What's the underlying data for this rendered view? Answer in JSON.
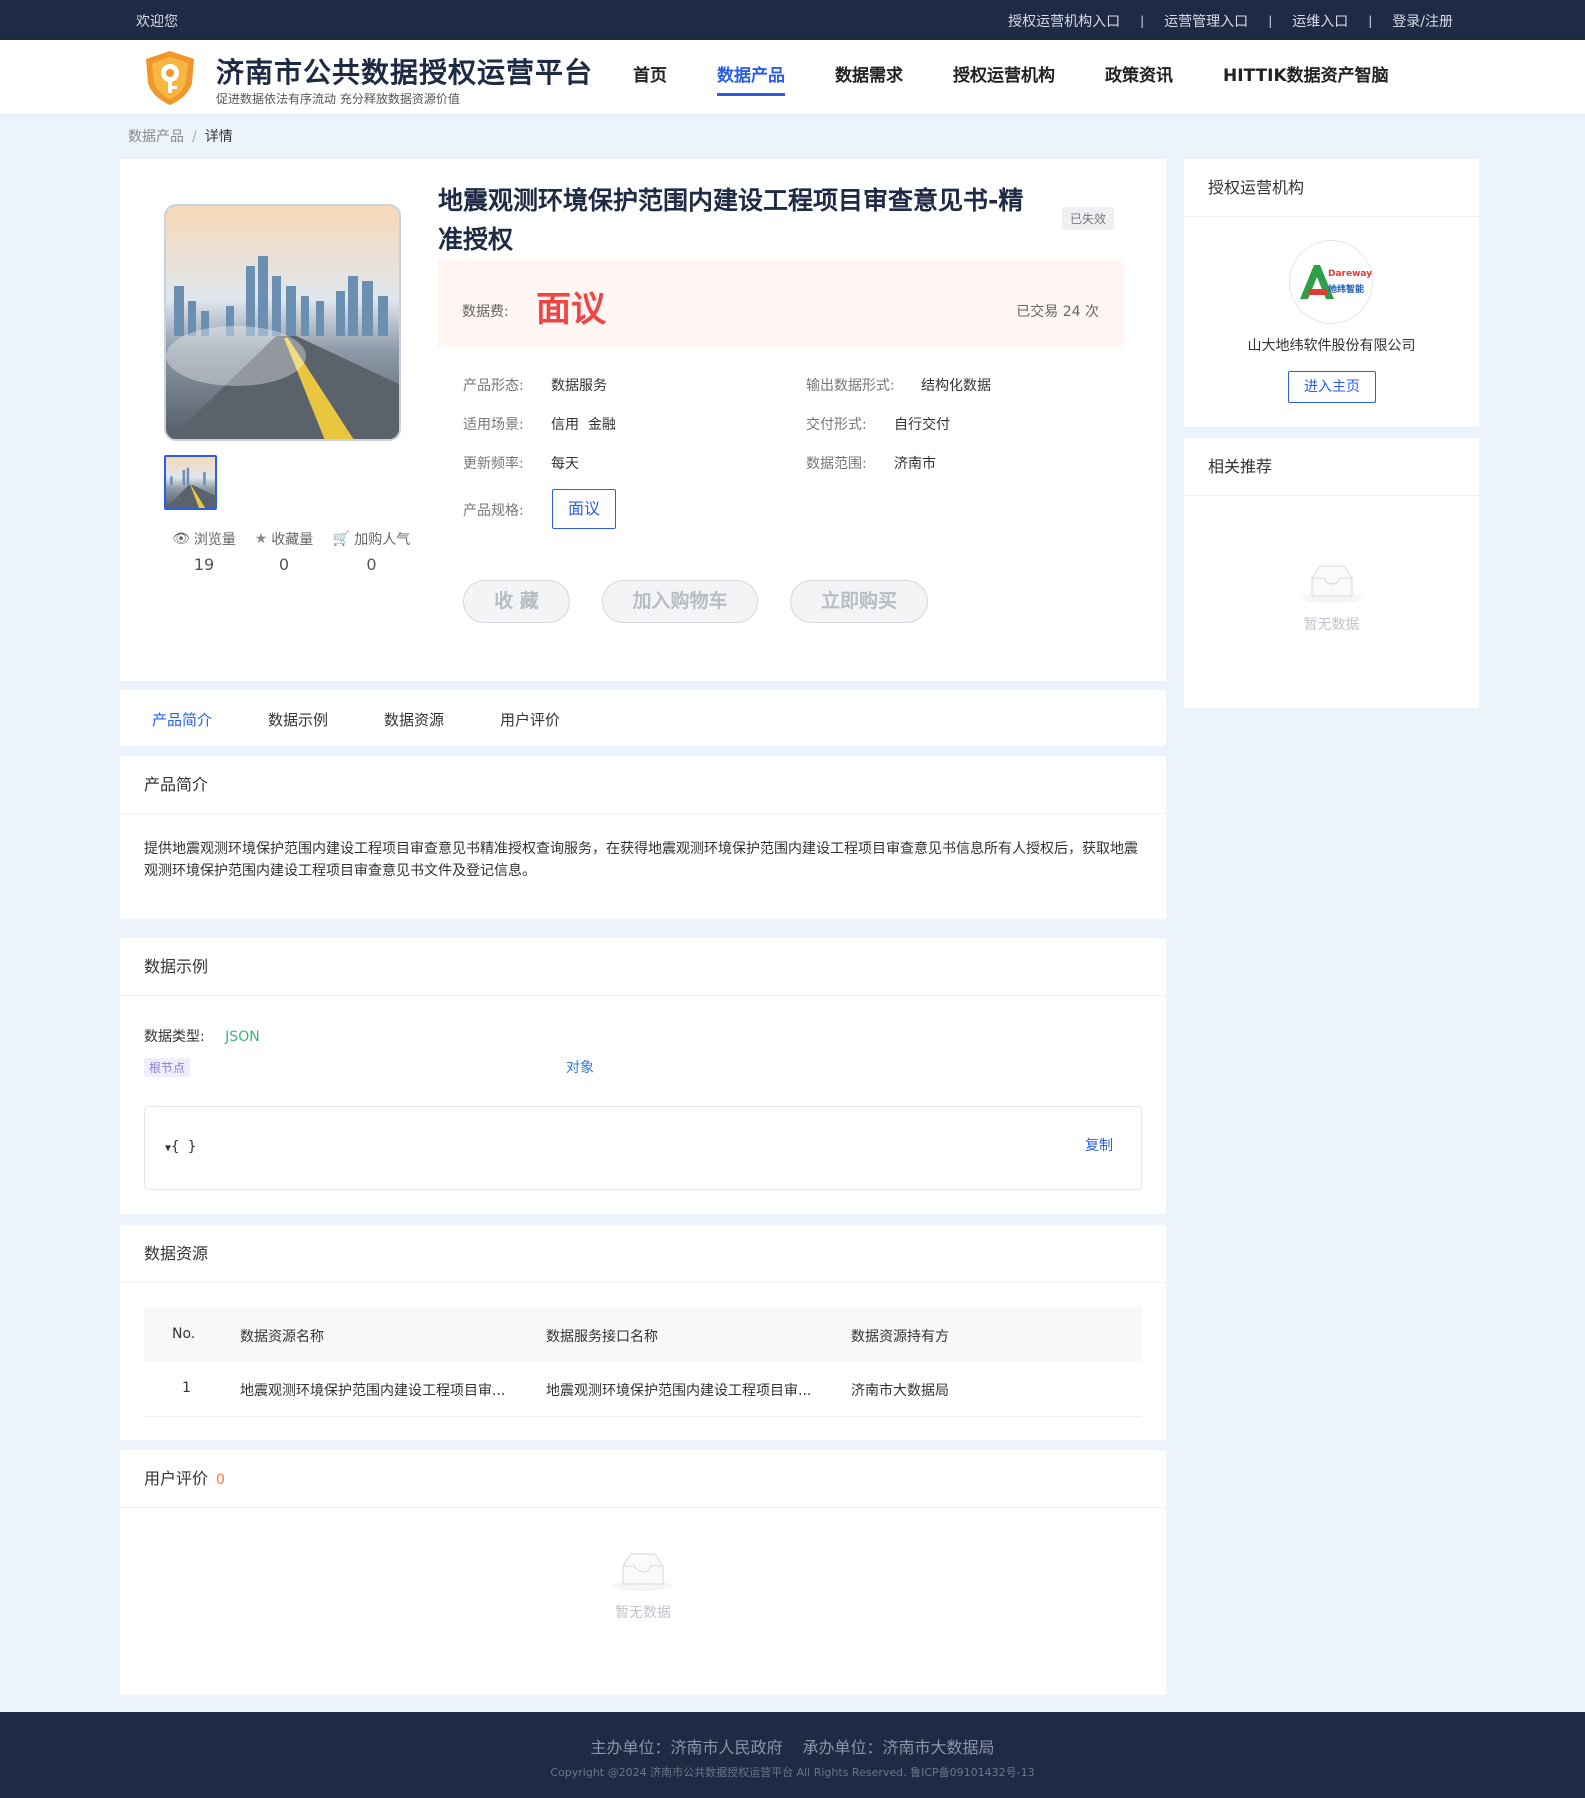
{
  "topbar": {
    "welcome": "欢迎您",
    "links": [
      "授权运营机构入口",
      "运营管理入口",
      "运维入口",
      "登录/注册"
    ]
  },
  "brand": {
    "title": "济南市公共数据授权运营平台",
    "subtitle": "促进数据依法有序流动 充分释放数据资源价值"
  },
  "nav": {
    "items": [
      "首页",
      "数据产品",
      "数据需求",
      "授权运营机构",
      "政策资讯",
      "HITTIK数据资产智脑"
    ],
    "active": "数据产品"
  },
  "breadcrumb": {
    "parent": "数据产品",
    "separator": "/",
    "current": "详情"
  },
  "product": {
    "title": "地震观测环境保护范围内建设工程项目审查意见书-精准授权",
    "status": "已失效",
    "price_label": "数据费:",
    "price": "面议",
    "traded": "已交易 24 次",
    "attrs": {
      "form_label": "产品形态:",
      "form": "数据服务",
      "output_label": "输出数据形式:",
      "output": "结构化数据",
      "scene_label": "适用场景:",
      "scene": "信用  金融",
      "delivery_label": "交付形式:",
      "delivery": "自行交付",
      "freq_label": "更新频率:",
      "freq": "每天",
      "range_label": "数据范围:",
      "range": "济南市",
      "spec_label": "产品规格:",
      "spec": "面议"
    },
    "stats": {
      "views_label": "浏览量",
      "views": "19",
      "favs_label": "收藏量",
      "favs": "0",
      "cart_label": "加购人气",
      "cart": "0"
    },
    "buttons": {
      "favorite": "收 藏",
      "add_cart": "加入购物车",
      "buy": "立即购买"
    }
  },
  "sidebar": {
    "org_title": "授权运营机构",
    "org_name": "山大地纬软件股份有限公司",
    "org_logo_text_1": "Dareway",
    "org_logo_text_2": "地纬智能",
    "org_button": "进入主页",
    "related_title": "相关推荐",
    "related_empty": "暂无数据"
  },
  "tabs": [
    "产品简介",
    "数据示例",
    "数据资源",
    "用户评价"
  ],
  "intro": {
    "title": "产品简介",
    "text": "提供地震观测环境保护范围内建设工程项目审查意见书精准授权查询服务，在获得地震观测环境保护范围内建设工程项目审查意见书信息所有人授权后，获取地震观测环境保护范围内建设工程项目审查意见书文件及登记信息。"
  },
  "example": {
    "title": "数据示例",
    "type_label": "数据类型:",
    "type": "JSON",
    "root_tag": "根节点",
    "root_type": "对象",
    "code": "{ }",
    "copy": "复制"
  },
  "resources": {
    "title": "数据资源",
    "columns": [
      "No.",
      "数据资源名称",
      "数据服务接口名称",
      "数据资源持有方"
    ],
    "rows": [
      [
        "1",
        "地震观测环境保护范围内建设工程项目审...",
        "地震观测环境保护范围内建设工程项目审...",
        "济南市大数据局"
      ]
    ]
  },
  "reviews": {
    "title": "用户评价",
    "count": "0",
    "empty": "暂无数据"
  },
  "footer": {
    "sponsor": "主办单位：济南市人民政府",
    "organizer": "承办单位：济南市大数据局",
    "copyright": "Copyright @2024 济南市公共数据授权运营平台 All Rights Reserved. 鲁ICP备09101432号-13"
  },
  "colors": {
    "primary": "#2b5ee8",
    "price": "#f04545",
    "dark": "#1f2a44",
    "json": "#3db37a",
    "count": "#f07a3a"
  }
}
